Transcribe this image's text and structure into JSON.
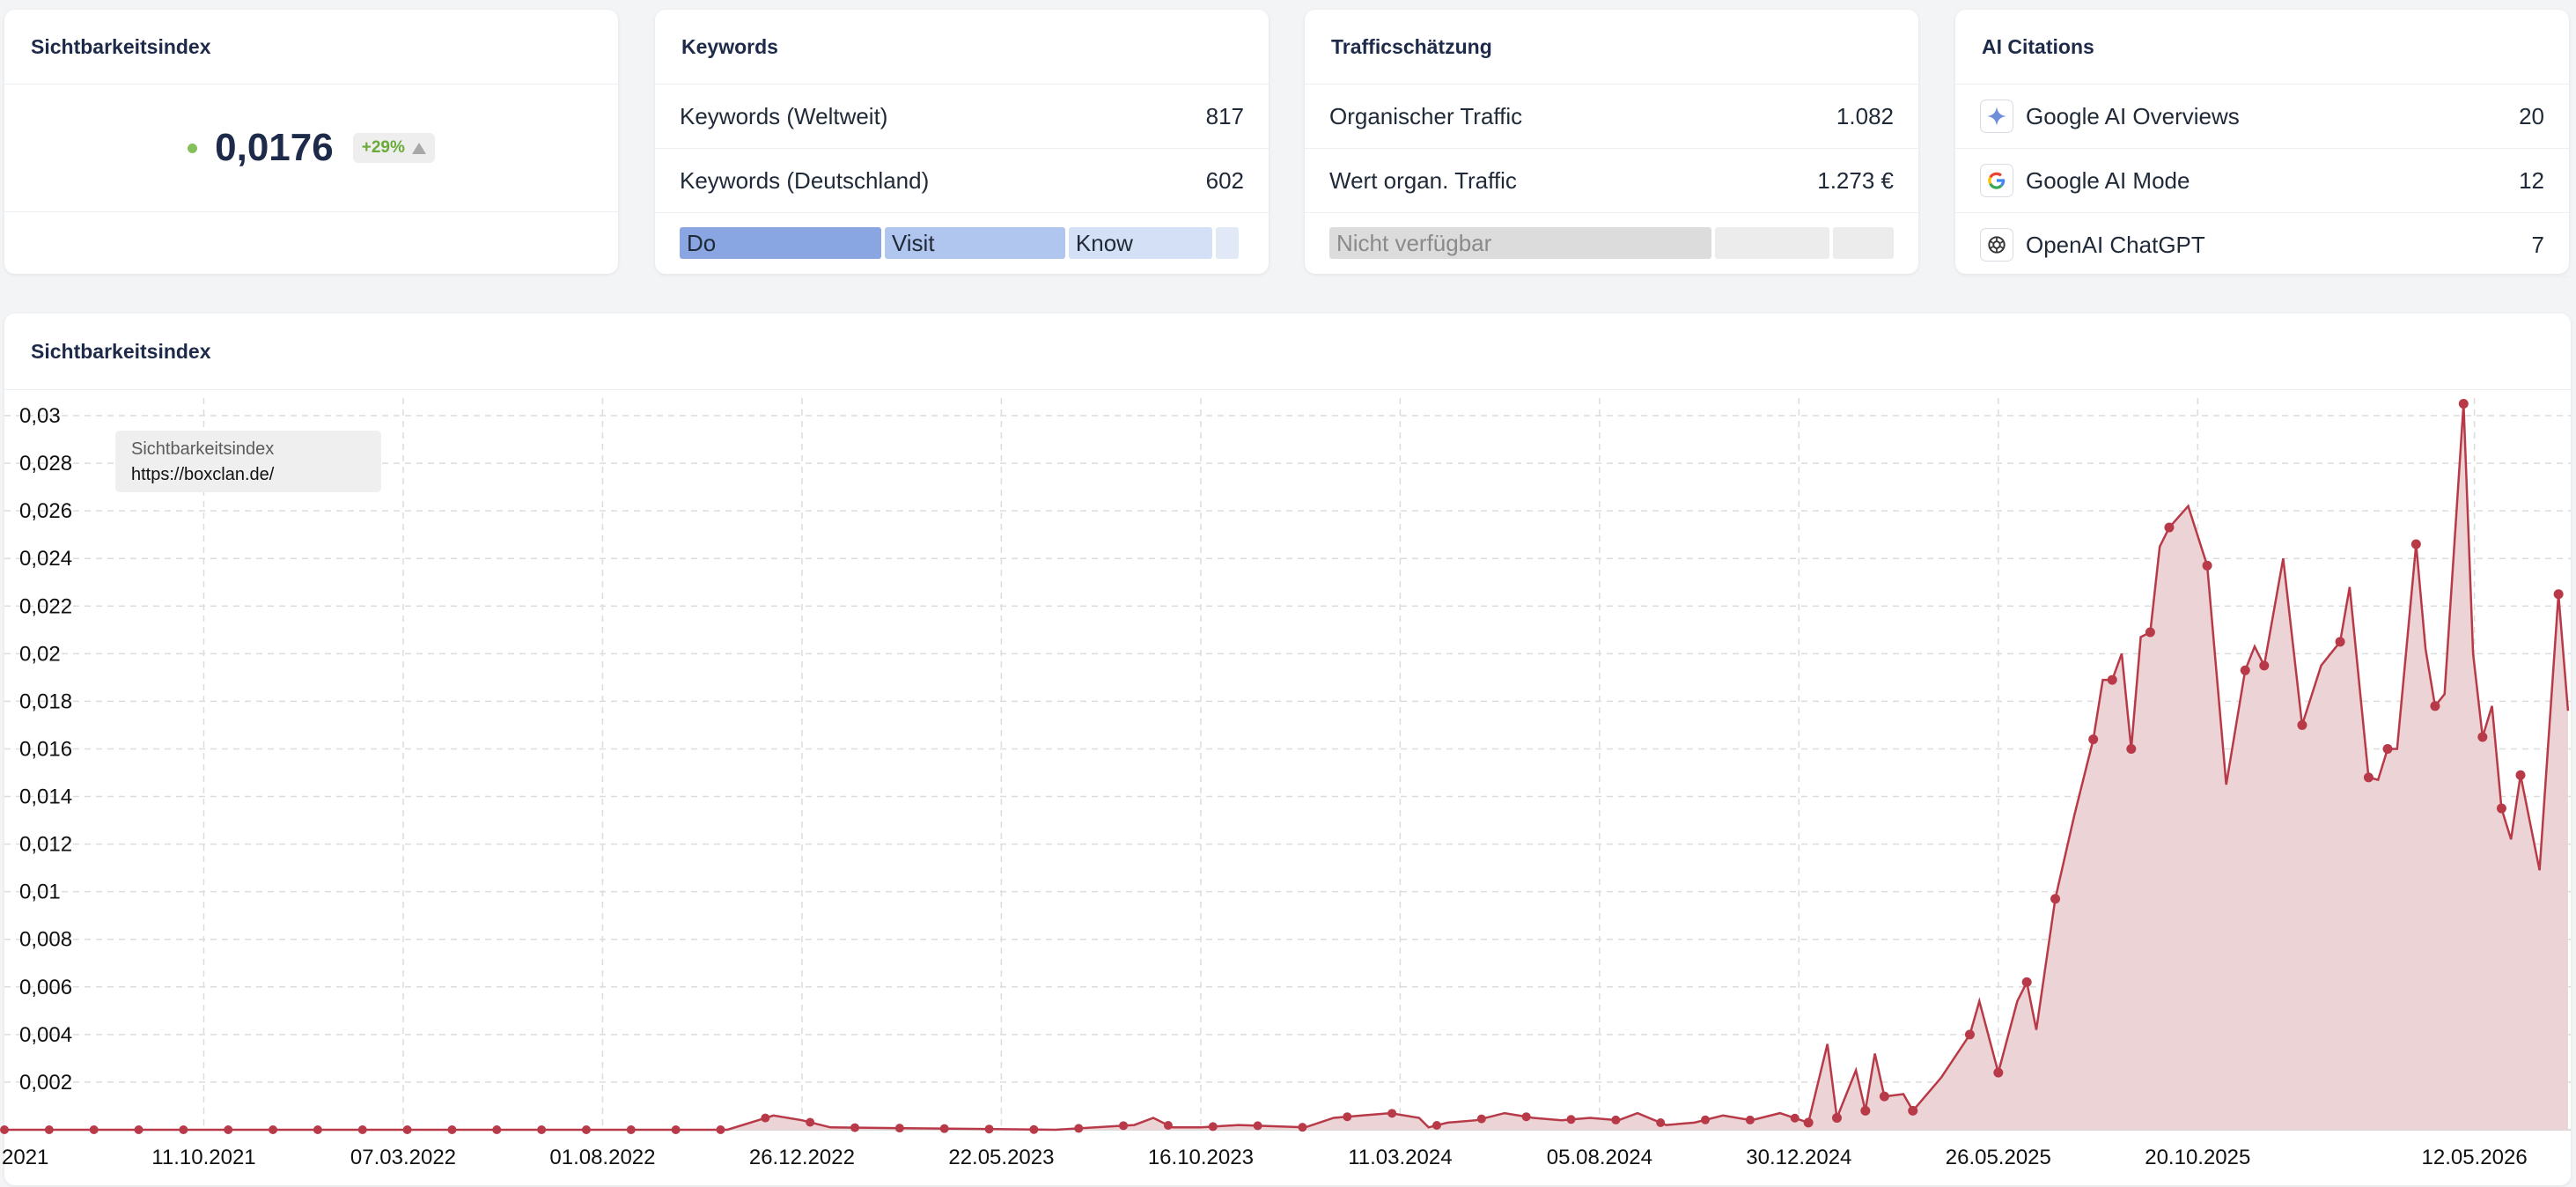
{
  "cards": {
    "visibility": {
      "title": "Sichtbarkeitsindex",
      "value": "0,0176",
      "change": "+29%"
    },
    "keywords": {
      "title": "Keywords",
      "rows": [
        {
          "label": "Keywords (Weltweit)",
          "value": "817"
        },
        {
          "label": "Keywords (Deutschland)",
          "value": "602"
        }
      ],
      "intent_segments": [
        {
          "label": "Do",
          "share": 0.37,
          "color": "#8aa6e2"
        },
        {
          "label": "Visit",
          "share": 0.33,
          "color": "#b1c6ef"
        },
        {
          "label": "Know",
          "share": 0.26,
          "color": "#d4e0f6"
        },
        {
          "label": "",
          "share": 0.03,
          "color": "#e1e8f6"
        }
      ]
    },
    "traffic": {
      "title": "Trafficschätzung",
      "rows": [
        {
          "label": "Organischer Traffic",
          "value": "1.082"
        },
        {
          "label": "Wert organ. Traffic",
          "value": "1.273 €"
        }
      ],
      "segments": [
        {
          "label": "Nicht verfügbar",
          "share": 0.7,
          "color": "#dcdcdc"
        },
        {
          "label": "",
          "share": 0.2,
          "color": "#ececec"
        },
        {
          "label": "",
          "share": 0.1,
          "color": "#ececec"
        }
      ]
    },
    "ai": {
      "title": "AI Citations",
      "rows": [
        {
          "label": "Google AI Overviews",
          "value": "20",
          "icon": "sparkle-icon"
        },
        {
          "label": "Google AI Mode",
          "value": "12",
          "icon": "google-g-icon"
        },
        {
          "label": "OpenAI ChatGPT",
          "value": "7",
          "icon": "openai-icon"
        }
      ]
    }
  },
  "chart_section": {
    "title": "Sichtbarkeitsindex"
  },
  "tooltip": {
    "series": "Sichtbarkeitsindex",
    "domain": "https://boxclan.de/"
  },
  "chart_data": {
    "type": "area",
    "xlabel": "",
    "ylabel": "",
    "ylim": [
      0,
      0.03
    ],
    "y_ticks": [
      "0,03",
      "0,028",
      "0,026",
      "0,024",
      "0,022",
      "0,02",
      "0,018",
      "0,016",
      "0,014",
      "0,012",
      "0,01",
      "0,008",
      "0,006",
      "0,004",
      "0,002"
    ],
    "x_ticks": [
      "2021",
      "11.10.2021",
      "07.03.2022",
      "01.08.2022",
      "26.12.2022",
      "22.05.2023",
      "16.10.2023",
      "11.03.2024",
      "05.08.2024",
      "30.12.2024",
      "26.05.2025",
      "20.10.2025",
      "12.05.2026"
    ],
    "grid": true,
    "color": "#b83a48",
    "fill": "#ecd3d5",
    "series": [
      {
        "name": "https://boxclan.de/",
        "points": [
          [
            "2021-05-17",
            0
          ],
          [
            "2021-11-01",
            0
          ],
          [
            "2022-06-01",
            0
          ],
          [
            "2022-11-01",
            0
          ],
          [
            "2022-12-05",
            0.0006
          ],
          [
            "2022-12-26",
            0.0004
          ],
          [
            "2023-01-16",
            0.0001
          ],
          [
            "2023-07-01",
            0
          ],
          [
            "2023-08-28",
            0.0002
          ],
          [
            "2023-09-11",
            0.0005
          ],
          [
            "2023-09-25",
            0.0001
          ],
          [
            "2023-10-16",
            0.0001
          ],
          [
            "2023-11-13",
            0.0002
          ],
          [
            "2024-01-01",
            0.0001
          ],
          [
            "2024-01-22",
            0.0005
          ],
          [
            "2024-02-12",
            0.0006
          ],
          [
            "2024-03-04",
            0.0007
          ],
          [
            "2024-03-25",
            0.0005
          ],
          [
            "2024-04-01",
            0.0001
          ],
          [
            "2024-04-15",
            0.0003
          ],
          [
            "2024-05-06",
            0.0004
          ],
          [
            "2024-05-27",
            0.0007
          ],
          [
            "2024-06-17",
            0.0005
          ],
          [
            "2024-07-08",
            0.0004
          ],
          [
            "2024-07-29",
            0.0005
          ],
          [
            "2024-08-19",
            0.0004
          ],
          [
            "2024-09-02",
            0.0007
          ],
          [
            "2024-09-23",
            0.0002
          ],
          [
            "2024-10-14",
            0.0003
          ],
          [
            "2024-11-04",
            0.0006
          ],
          [
            "2024-11-25",
            0.0004
          ],
          [
            "2024-12-16",
            0.0007
          ],
          [
            "2025-01-06",
            0.0003
          ],
          [
            "2025-01-20",
            0.0036
          ],
          [
            "2025-01-27",
            0.0005
          ],
          [
            "2025-02-10",
            0.0025
          ],
          [
            "2025-02-17",
            0.0008
          ],
          [
            "2025-02-24",
            0.0032
          ],
          [
            "2025-03-03",
            0.0014
          ],
          [
            "2025-03-17",
            0.0015
          ],
          [
            "2025-03-24",
            0.0008
          ],
          [
            "2025-04-14",
            0.0022
          ],
          [
            "2025-05-05",
            0.004
          ],
          [
            "2025-05-12",
            0.0054
          ],
          [
            "2025-05-26",
            0.0024
          ],
          [
            "2025-06-09",
            0.0054
          ],
          [
            "2025-06-16",
            0.0062
          ],
          [
            "2025-06-23",
            0.0042
          ],
          [
            "2025-07-07",
            0.0097
          ],
          [
            "2025-07-21",
            0.0132
          ],
          [
            "2025-08-04",
            0.0164
          ],
          [
            "2025-08-11",
            0.0189
          ],
          [
            "2025-08-18",
            0.0189
          ],
          [
            "2025-08-25",
            0.02
          ],
          [
            "2025-09-01",
            0.016
          ],
          [
            "2025-09-08",
            0.0207
          ],
          [
            "2025-09-15",
            0.0209
          ],
          [
            "2025-09-22",
            0.0245
          ],
          [
            "2025-09-29",
            0.0253
          ],
          [
            "2025-10-13",
            0.0262
          ],
          [
            "2025-10-27",
            0.0237
          ],
          [
            "2025-11-10",
            0.0145
          ],
          [
            "2025-11-24",
            0.0193
          ],
          [
            "2025-12-01",
            0.0203
          ],
          [
            "2025-12-08",
            0.0195
          ],
          [
            "2025-12-22",
            0.024
          ],
          [
            "2026-01-05",
            0.017
          ],
          [
            "2026-01-19",
            0.0195
          ],
          [
            "2026-02-02",
            0.0205
          ],
          [
            "2026-02-09",
            0.0228
          ],
          [
            "2026-02-23",
            0.0148
          ],
          [
            "2026-03-02",
            0.0147
          ],
          [
            "2026-03-09",
            0.016
          ],
          [
            "2026-03-16",
            0.016
          ],
          [
            "2026-03-30",
            0.0246
          ],
          [
            "2026-04-06",
            0.0202
          ],
          [
            "2026-04-13",
            0.0178
          ],
          [
            "2026-04-20",
            0.0183
          ],
          [
            "2026-05-04",
            0.0305
          ],
          [
            "2026-05-11",
            0.02
          ],
          [
            "2026-05-18",
            0.0165
          ],
          [
            "2026-05-25",
            0.0178
          ],
          [
            "2026-06-01",
            0.0135
          ],
          [
            "2026-06-08",
            0.0122
          ],
          [
            "2026-06-15",
            0.0149
          ],
          [
            "2026-06-29",
            0.0109
          ],
          [
            "2026-07-13",
            0.0225
          ],
          [
            "2026-07-20",
            0.0176
          ]
        ]
      }
    ]
  }
}
